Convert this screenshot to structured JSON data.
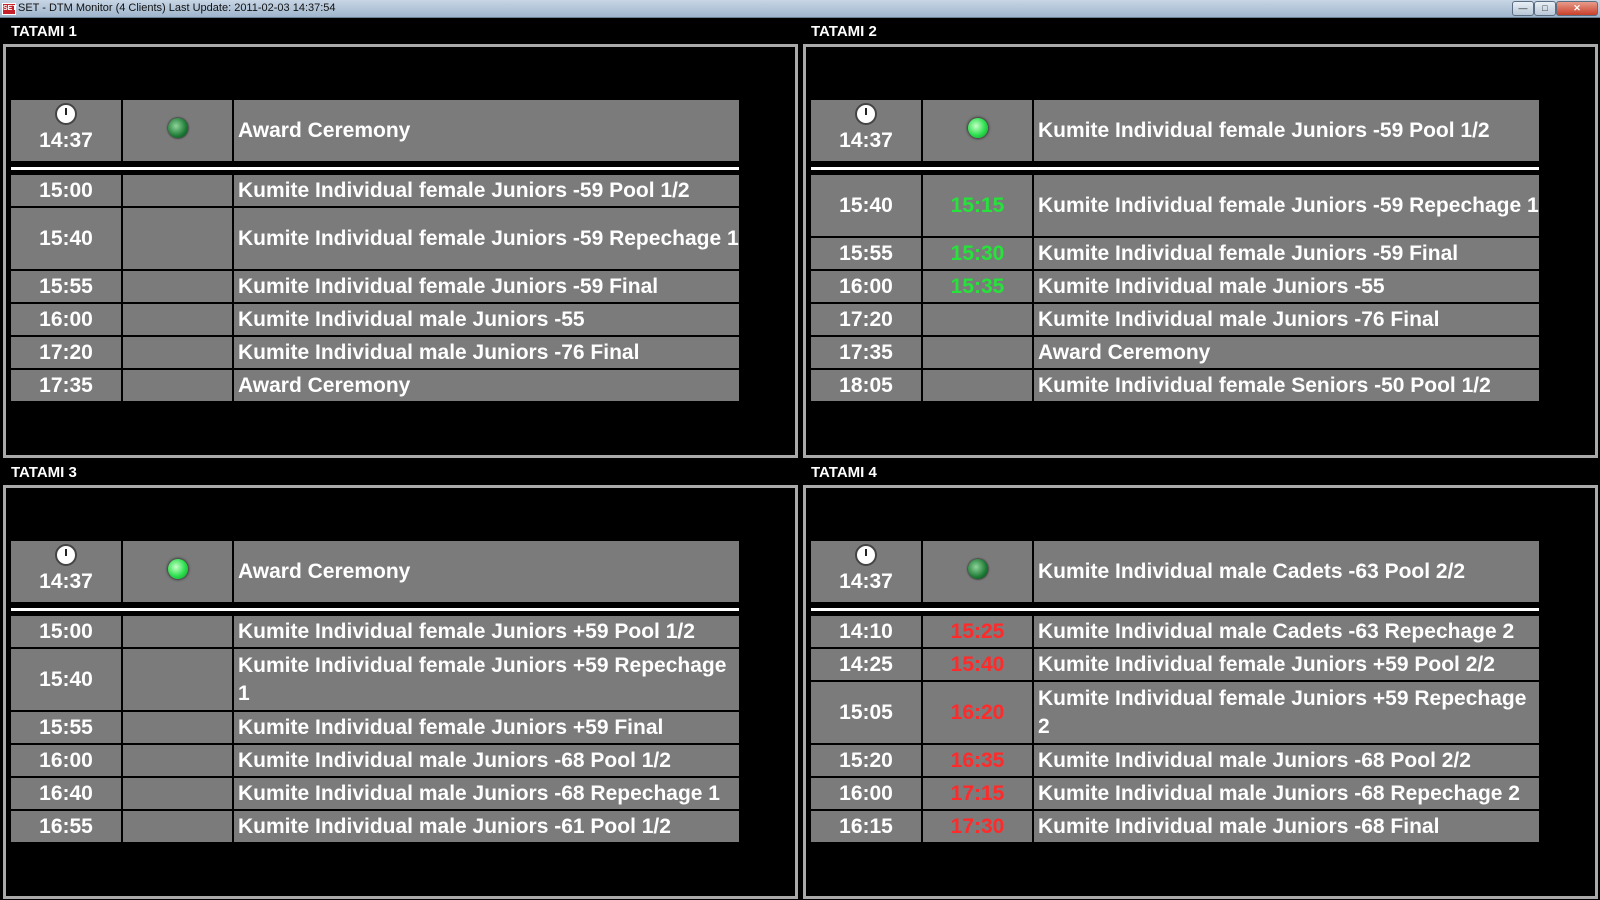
{
  "window": {
    "title": "SET - DTM Monitor (4 Clients) Last Update: 2011-02-03 14:37:54",
    "icon_text": "SET"
  },
  "tatamis": [
    {
      "label": "TATAMI 1",
      "current": {
        "clock": "14:37",
        "led": "dim",
        "name": "Award Ceremony"
      },
      "rows": [
        {
          "time": "15:00",
          "est": "",
          "name": "Kumite Individual female Juniors -59 Pool 1/2"
        },
        {
          "time": "15:40",
          "est": "",
          "name": "Kumite Individual female Juniors -59 Repechage 1"
        },
        {
          "time": "15:55",
          "est": "",
          "name": "Kumite Individual female Juniors -59 Final"
        },
        {
          "time": "16:00",
          "est": "",
          "name": "Kumite Individual male Juniors -55"
        },
        {
          "time": "17:20",
          "est": "",
          "name": "Kumite Individual male Juniors -76 Final"
        },
        {
          "time": "17:35",
          "est": "",
          "name": "Award Ceremony"
        }
      ]
    },
    {
      "label": "TATAMI 2",
      "current": {
        "clock": "14:37",
        "led": "bright",
        "name": "Kumite Individual female Juniors -59 Pool 1/2"
      },
      "rows": [
        {
          "time": "15:40",
          "est": "15:15",
          "est_color": "green",
          "name": "Kumite Individual female Juniors -59 Repechage 1"
        },
        {
          "time": "15:55",
          "est": "15:30",
          "est_color": "green",
          "name": "Kumite Individual female Juniors -59 Final"
        },
        {
          "time": "16:00",
          "est": "15:35",
          "est_color": "green",
          "name": "Kumite Individual male Juniors -55"
        },
        {
          "time": "17:20",
          "est": "",
          "name": "Kumite Individual male Juniors -76 Final"
        },
        {
          "time": "17:35",
          "est": "",
          "name": "Award Ceremony"
        },
        {
          "time": "18:05",
          "est": "",
          "name": "Kumite Individual female Seniors -50 Pool 1/2"
        }
      ]
    },
    {
      "label": "TATAMI 3",
      "current": {
        "clock": "14:37",
        "led": "bright",
        "name": "Award Ceremony"
      },
      "rows": [
        {
          "time": "15:00",
          "est": "",
          "name": "Kumite Individual female Juniors +59 Pool 1/2"
        },
        {
          "time": "15:40",
          "est": "",
          "name": "Kumite Individual female Juniors +59 Repechage 1"
        },
        {
          "time": "15:55",
          "est": "",
          "name": "Kumite Individual female Juniors +59 Final"
        },
        {
          "time": "16:00",
          "est": "",
          "name": "Kumite Individual male Juniors -68 Pool 1/2"
        },
        {
          "time": "16:40",
          "est": "",
          "name": "Kumite Individual male Juniors -68 Repechage 1"
        },
        {
          "time": "16:55",
          "est": "",
          "name": "Kumite Individual male Juniors -61 Pool 1/2"
        }
      ]
    },
    {
      "label": "TATAMI 4",
      "current": {
        "clock": "14:37",
        "led": "dim",
        "name": "Kumite Individual male Cadets -63 Pool 2/2"
      },
      "rows": [
        {
          "time": "14:10",
          "est": "15:25",
          "est_color": "red",
          "name": "Kumite Individual male Cadets -63 Repechage 2"
        },
        {
          "time": "14:25",
          "est": "15:40",
          "est_color": "red",
          "name": "Kumite Individual female Juniors +59 Pool 2/2"
        },
        {
          "time": "15:05",
          "est": "16:20",
          "est_color": "red",
          "name": "Kumite Individual female Juniors +59 Repechage 2"
        },
        {
          "time": "15:20",
          "est": "16:35",
          "est_color": "red",
          "name": "Kumite Individual male Juniors -68 Pool 2/2"
        },
        {
          "time": "16:00",
          "est": "17:15",
          "est_color": "red",
          "name": "Kumite Individual male Juniors -68 Repechage 2"
        },
        {
          "time": "16:15",
          "est": "17:30",
          "est_color": "red",
          "name": "Kumite Individual male Juniors -68 Final"
        }
      ]
    }
  ]
}
